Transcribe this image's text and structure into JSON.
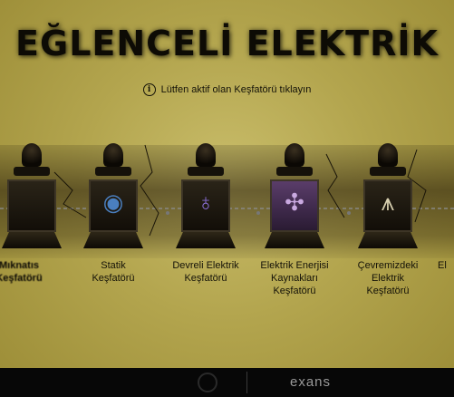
{
  "title": "EĞLENCELİ ELEKTRİK",
  "hint": {
    "icon": "info-icon",
    "text": "Lütfen aktif olan Keşfatörü tıklayın"
  },
  "devices": [
    {
      "label": "Mıknatıs\nKeşfatörü",
      "icon": "magnet-icon",
      "glyph": ""
    },
    {
      "label": "Statik\nKeşfatörü",
      "icon": "static-ball-icon",
      "glyph": "◉"
    },
    {
      "label": "Devreli Elektrik\nKeşfatörü",
      "icon": "lightbulb-icon",
      "glyph": "♁"
    },
    {
      "label": "Elektrik Enerjisi\nKaynakları\nKeşfatörü",
      "icon": "wind-turbine-icon",
      "glyph": "✣"
    },
    {
      "label": "Çevremizdeki\nElektrik\nKeşfatörü",
      "icon": "power-tower-icon",
      "glyph": "⩚"
    },
    {
      "label": "El",
      "icon": "",
      "glyph": ""
    }
  ],
  "footer": {
    "brand": "exans"
  },
  "colors": {
    "background": "#b3a54e",
    "footer": "#070707"
  }
}
